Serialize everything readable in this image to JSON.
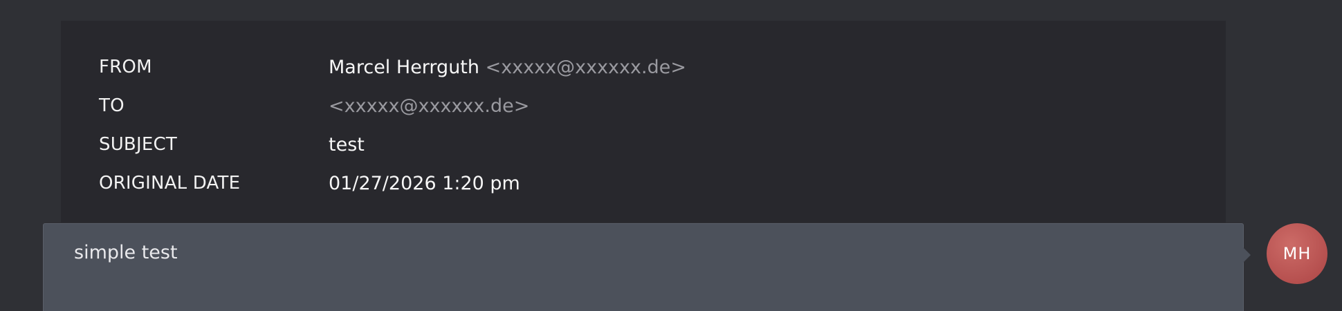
{
  "message_header": {
    "from": {
      "label": "FROM",
      "name": "Marcel Herrguth",
      "email": "<xxxxx@xxxxxx.de>"
    },
    "to": {
      "label": "TO",
      "email": "<xxxxx@xxxxxx.de>"
    },
    "subject": {
      "label": "SUBJECT",
      "value": "test"
    },
    "original_date": {
      "label": "ORIGINAL DATE",
      "value": "01/27/2026 1:20 pm"
    }
  },
  "message_bubble": {
    "text": "simple test"
  },
  "avatar": {
    "initials": "MH"
  }
}
